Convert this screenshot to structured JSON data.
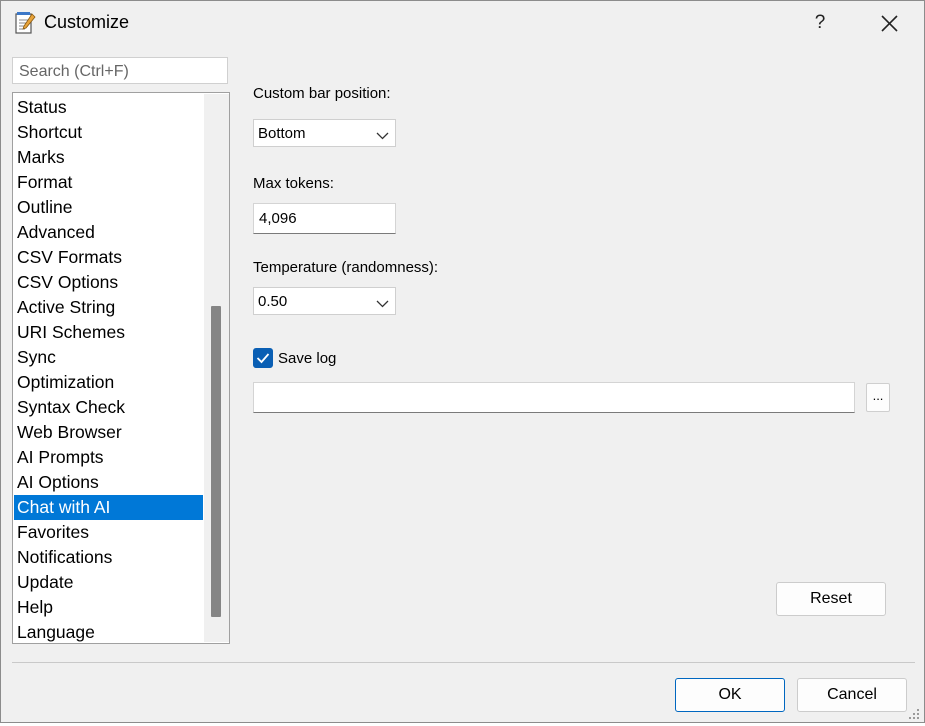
{
  "window": {
    "title": "Customize",
    "help_label": "?"
  },
  "sidebar": {
    "search_placeholder": "Search (Ctrl+F)",
    "items": [
      {
        "label": "Status"
      },
      {
        "label": "Shortcut"
      },
      {
        "label": "Marks"
      },
      {
        "label": "Format"
      },
      {
        "label": "Outline"
      },
      {
        "label": "Advanced"
      },
      {
        "label": "CSV Formats"
      },
      {
        "label": "CSV Options"
      },
      {
        "label": "Active String"
      },
      {
        "label": "URI Schemes"
      },
      {
        "label": "Sync"
      },
      {
        "label": "Optimization"
      },
      {
        "label": "Syntax Check"
      },
      {
        "label": "Web Browser"
      },
      {
        "label": "AI Prompts"
      },
      {
        "label": "AI Options"
      },
      {
        "label": "Chat with AI"
      },
      {
        "label": "Favorites"
      },
      {
        "label": "Notifications"
      },
      {
        "label": "Update"
      },
      {
        "label": "Help"
      },
      {
        "label": "Language"
      }
    ],
    "selected": "Chat with AI"
  },
  "settings": {
    "bar_position_label": "Custom bar position:",
    "bar_position_value": "Bottom",
    "max_tokens_label": "Max tokens:",
    "max_tokens_value": "4,096",
    "temperature_label": "Temperature (randomness):",
    "temperature_value": "0.50",
    "save_log_label": "Save log",
    "save_log_checked": true,
    "log_path_value": "",
    "browse_label": "...",
    "reset_label": "Reset"
  },
  "footer": {
    "ok_label": "OK",
    "cancel_label": "Cancel"
  },
  "colors": {
    "accent": "#0078d7",
    "checkbox": "#0a5fb4",
    "background": "#f0f0f0"
  }
}
